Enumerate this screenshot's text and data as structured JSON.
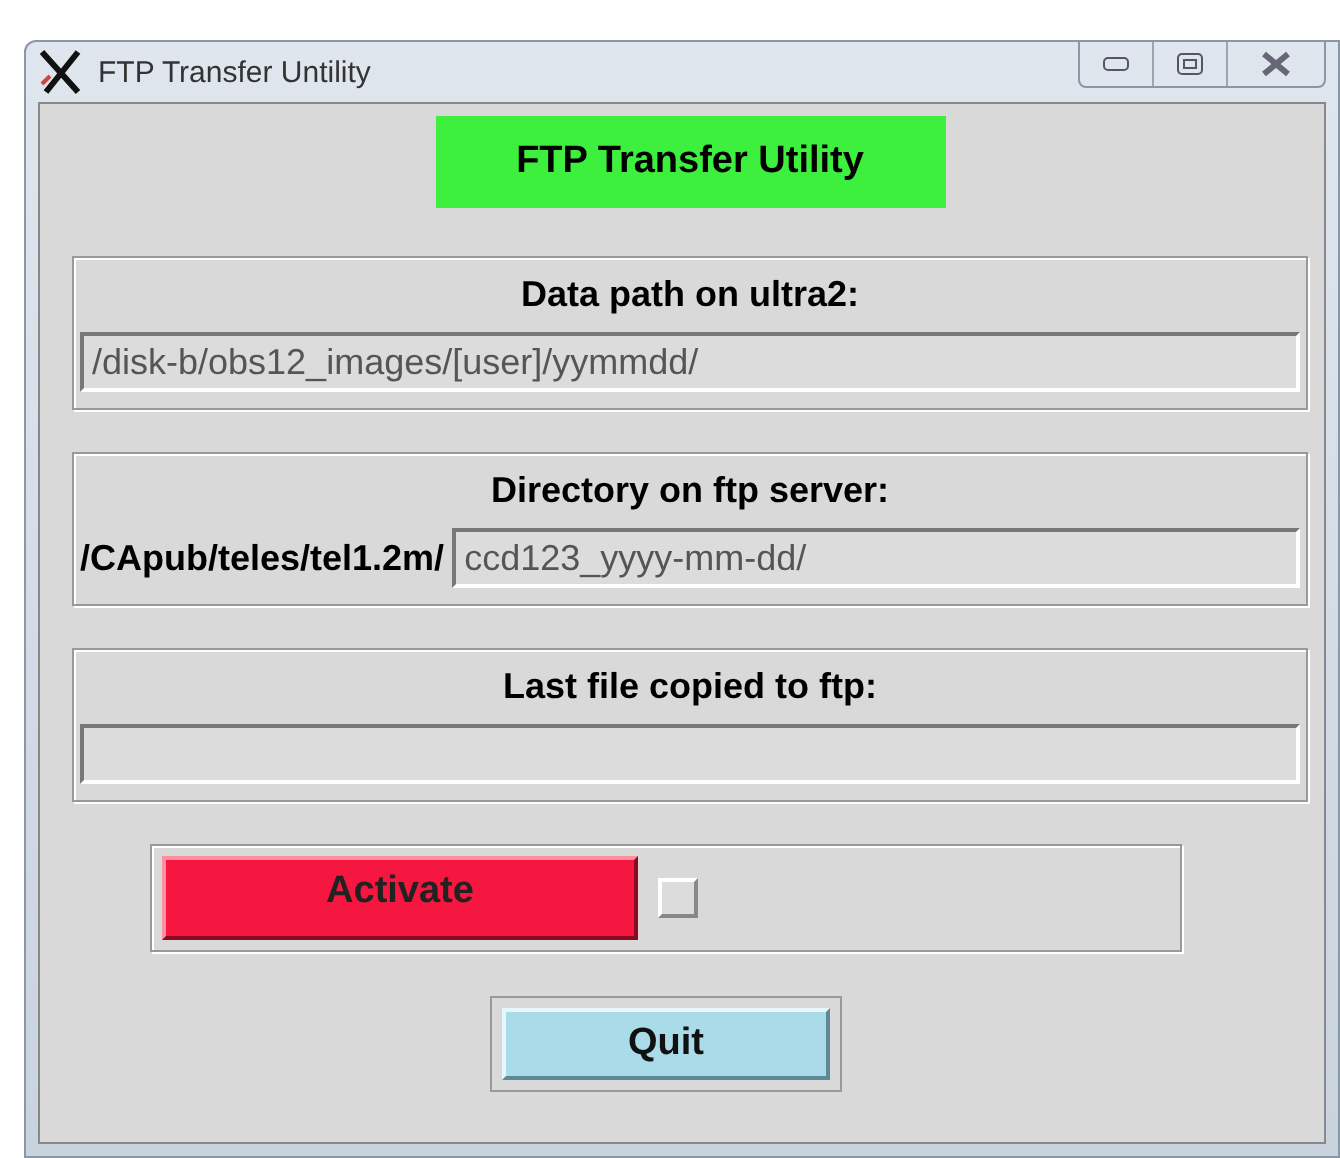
{
  "window": {
    "title": "FTP Transfer Untility"
  },
  "banner": "FTP Transfer Utility",
  "data_path": {
    "label": "Data path on ultra2:",
    "value": "/disk-b/obs12_images/[user]/yymmdd/"
  },
  "ftp_dir": {
    "label": "Directory on ftp server:",
    "prefix": "/CApub/teles/tel1.2m/",
    "value": "ccd123_yyyy-mm-dd/"
  },
  "last_file": {
    "label": "Last file copied to ftp:"
  },
  "activate": {
    "label": "Activate",
    "checked": false
  },
  "quit": "Quit"
}
